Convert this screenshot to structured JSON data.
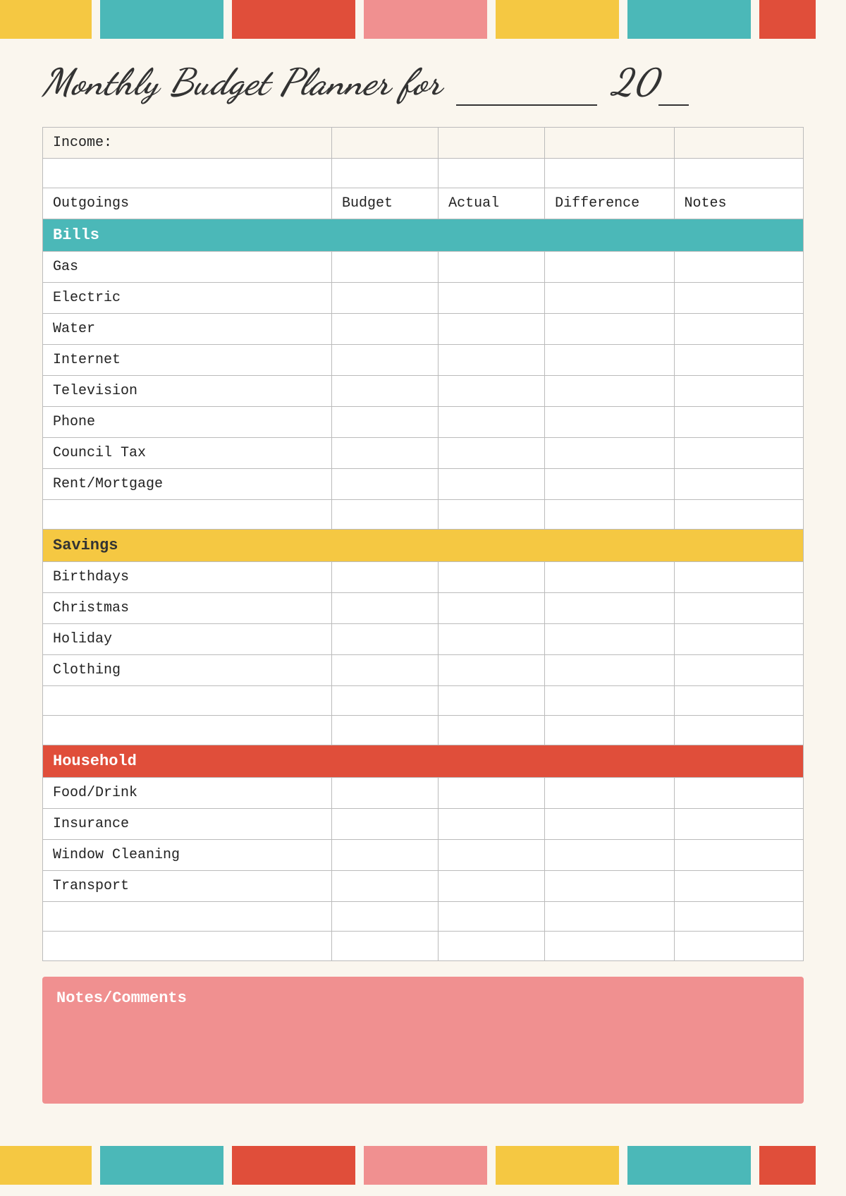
{
  "topBars": [
    {
      "color": "yellow",
      "label": "yellow-bar"
    },
    {
      "color": "teal",
      "label": "teal-bar"
    },
    {
      "color": "red",
      "label": "red-bar"
    },
    {
      "color": "pink",
      "label": "pink-bar"
    },
    {
      "color": "yellow2",
      "label": "yellow2-bar"
    },
    {
      "color": "teal2",
      "label": "teal2-bar"
    },
    {
      "color": "red2",
      "label": "red2-bar"
    }
  ],
  "title": {
    "part1": "Monthly Budget Planner for",
    "part2": "20"
  },
  "table": {
    "incomeLabel": "Income:",
    "headers": {
      "outgoings": "Outgoings",
      "budget": "Budget",
      "actual": "Actual",
      "difference": "Difference",
      "notes": "Notes"
    },
    "sections": [
      {
        "id": "bills",
        "label": "Bills",
        "color": "teal",
        "items": [
          "Gas",
          "Electric",
          "Water",
          "Internet",
          "Television",
          "Phone",
          "Council Tax",
          "Rent/Mortgage"
        ]
      },
      {
        "id": "savings",
        "label": "Savings",
        "color": "yellow",
        "items": [
          "Birthdays",
          "Christmas",
          "Holiday",
          "Clothing"
        ]
      },
      {
        "id": "household",
        "label": "Household",
        "color": "red",
        "items": [
          "Food/Drink",
          "Insurance",
          "Window Cleaning",
          "Transport"
        ]
      }
    ]
  },
  "notes": {
    "label": "Notes/Comments"
  }
}
